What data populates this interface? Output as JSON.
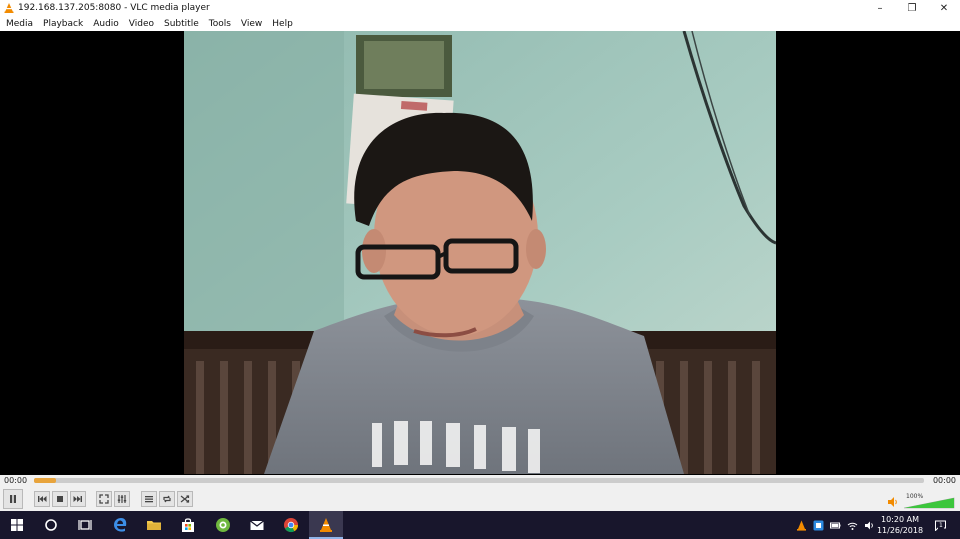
{
  "window": {
    "title": "192.168.137.205:8080 - VLC media player",
    "controls": {
      "minimize": "–",
      "restore": "❐",
      "close": "✕"
    }
  },
  "menu": [
    "Media",
    "Playback",
    "Audio",
    "Video",
    "Subtitle",
    "Tools",
    "View",
    "Help"
  ],
  "playback": {
    "elapsed": "00:00",
    "remaining": "00:00",
    "progress_fraction": 0.025,
    "state": "playing"
  },
  "volume": {
    "label": "100%",
    "level_fraction": 1.0
  },
  "taskbar": {
    "apps": [
      "windows-start",
      "cortana",
      "task-view",
      "edge",
      "file-explorer",
      "store",
      "greenshot",
      "mail",
      "chrome",
      "vlc"
    ],
    "active_app": "vlc",
    "clock_time": "10:20 AM",
    "clock_date": "11/26/2018",
    "notification_count": "1"
  },
  "colors": {
    "seek_fill": "#e8a43c",
    "vlc_orange": "#f28b00",
    "taskbar_bg": "#18162c",
    "volume_green": "#3cc63c"
  }
}
